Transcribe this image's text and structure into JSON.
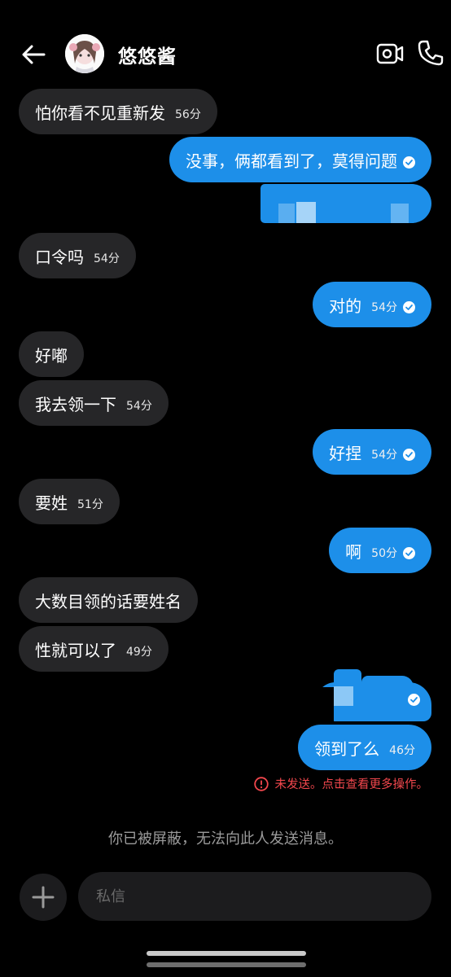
{
  "header": {
    "contact_name": "悠悠酱"
  },
  "messages": [
    {
      "dir": "in",
      "text": "怕你看不见重新发",
      "time": "56分"
    },
    {
      "dir": "out",
      "text": "没事，俩都看到了，莫得问题",
      "read": true
    },
    {
      "dir": "in",
      "text": "口令吗",
      "time": "54分"
    },
    {
      "dir": "out",
      "text": "对的",
      "time": "54分",
      "read": true
    },
    {
      "dir": "in",
      "text": "好嘟"
    },
    {
      "dir": "in",
      "text": "我去领一下",
      "time": "54分"
    },
    {
      "dir": "out",
      "text": "好捏",
      "time": "54分",
      "read": true
    },
    {
      "dir": "in",
      "text": "要姓",
      "time": "51分"
    },
    {
      "dir": "out",
      "text": "啊",
      "time": "50分",
      "read": true
    },
    {
      "dir": "in",
      "text": "大数目领的话要姓名"
    },
    {
      "dir": "in",
      "text": "性就可以了",
      "time": "49分"
    },
    {
      "dir": "out",
      "text": "领到了么",
      "time": "46分"
    }
  ],
  "error": {
    "text": "未发送。点击查看更多操作。",
    "color": "#f2474d"
  },
  "blocked_notice": "你已被屏蔽，无法向此人发送消息。",
  "composer": {
    "placeholder": "私信"
  },
  "colors": {
    "outgoing": "#1d8fe9",
    "incoming": "#262628",
    "background": "#000000"
  }
}
